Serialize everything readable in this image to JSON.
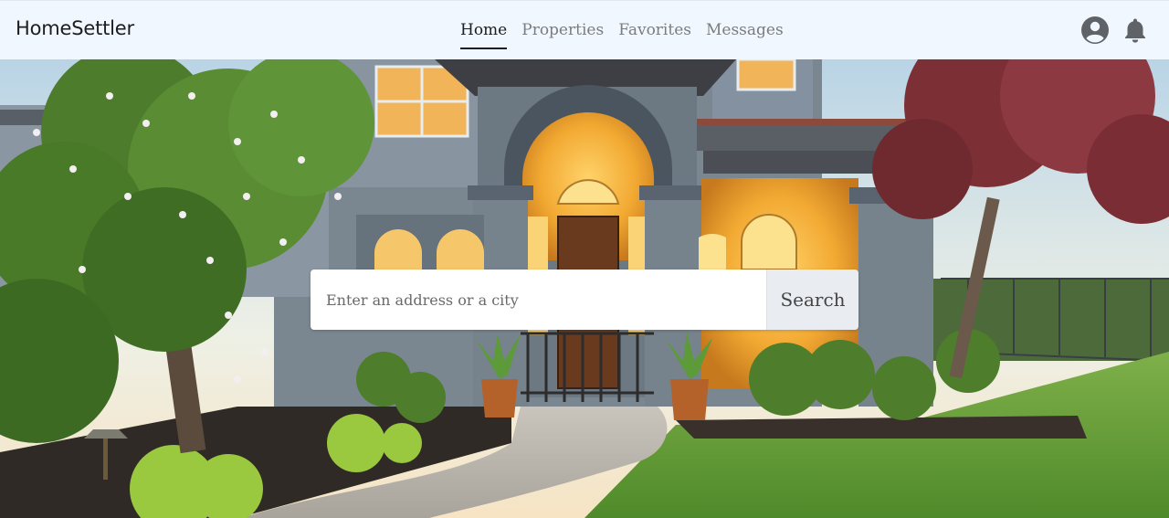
{
  "app": {
    "title": "HomeSettler"
  },
  "nav": {
    "items": [
      {
        "label": "Home",
        "active": true
      },
      {
        "label": "Properties",
        "active": false
      },
      {
        "label": "Favorites",
        "active": false
      },
      {
        "label": "Messages",
        "active": false
      }
    ]
  },
  "header_icons": {
    "user": "user-icon",
    "notifications": "bell-icon"
  },
  "search": {
    "placeholder": "Enter an address or a city",
    "value": "",
    "button_label": "Search"
  },
  "hero": {
    "image": "house-exterior-photo"
  },
  "colors": {
    "header_bg": "#f1f7fe",
    "active_nav": "#1e1e1e",
    "inactive_nav": "#7c7c7c",
    "icon": "#5f6368"
  }
}
